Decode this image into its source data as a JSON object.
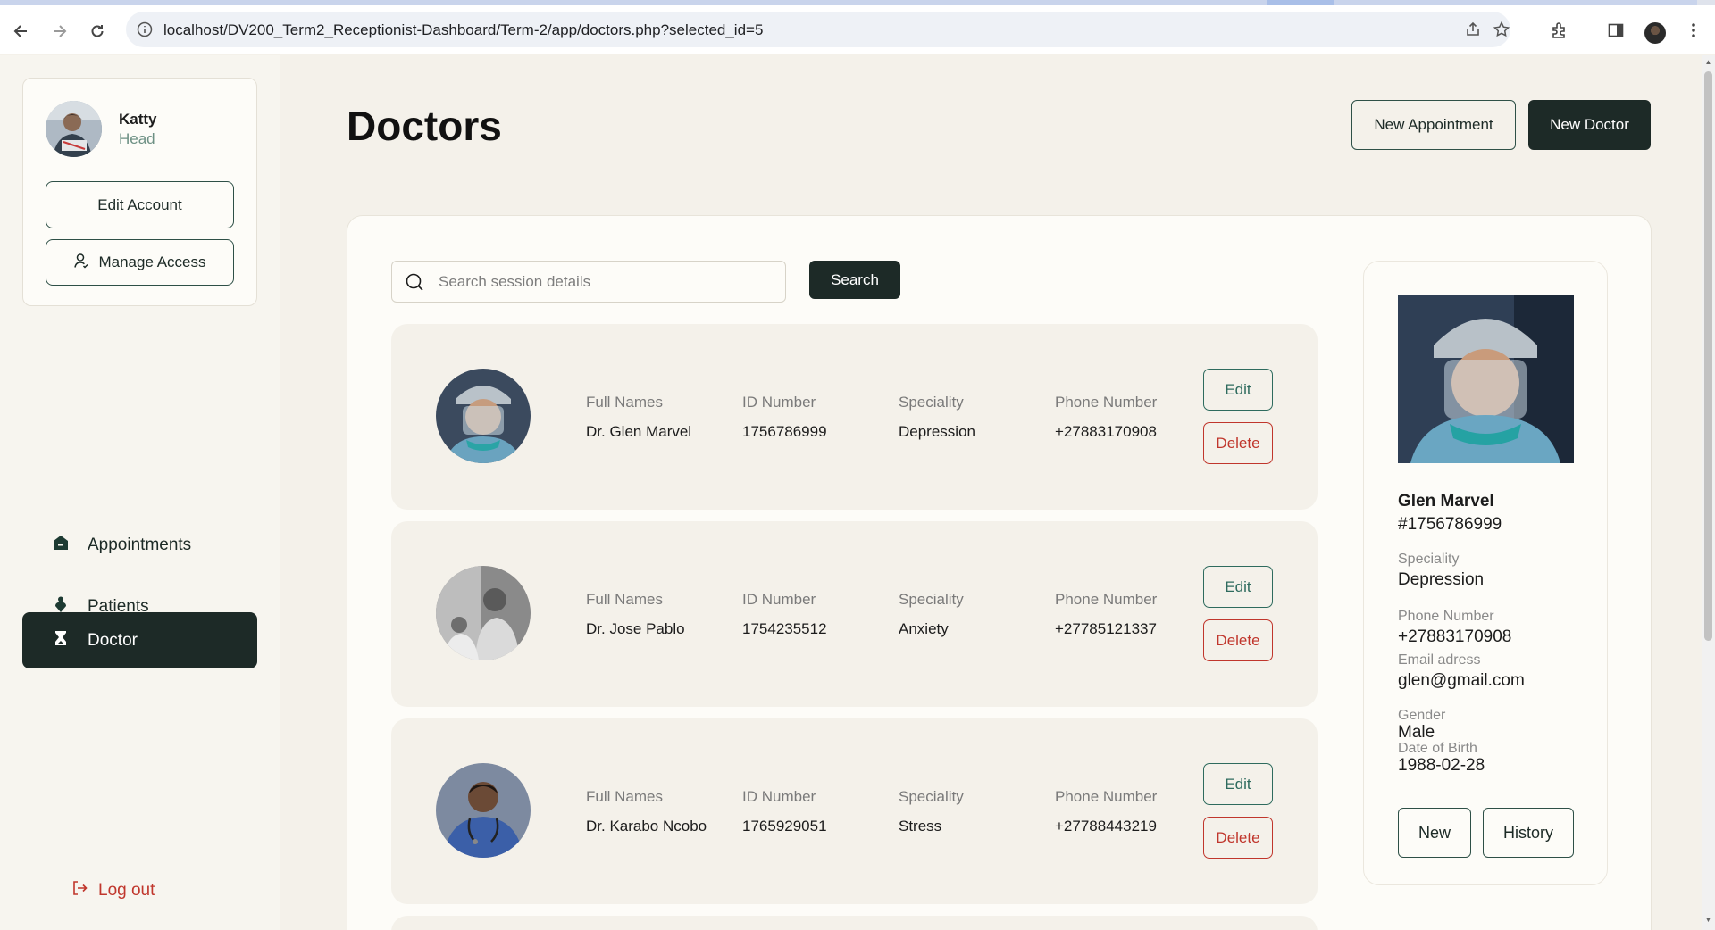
{
  "browser": {
    "url": "localhost/DV200_Term2_Receptionist-Dashboard/Term-2/app/doctors.php?selected_id=5"
  },
  "sidebar": {
    "user": {
      "name": "Katty",
      "role": "Head"
    },
    "edit_account_label": "Edit Account",
    "manage_access_label": "Manage Access",
    "nav": [
      {
        "label": "Appointments",
        "icon": "home-icon",
        "active": false
      },
      {
        "label": "Patients",
        "icon": "person-pin-icon",
        "active": false
      },
      {
        "label": "Doctor",
        "icon": "hourglass-icon",
        "active": true
      }
    ],
    "logout_label": "Log out"
  },
  "header": {
    "title": "Doctors",
    "new_appointment_label": "New Appointment",
    "new_doctor_label": "New Doctor"
  },
  "search": {
    "placeholder": "Search session details",
    "button_label": "Search"
  },
  "table": {
    "labels": {
      "full_names": "Full Names",
      "id_number": "ID Number",
      "speciality": "Speciality",
      "phone_number": "Phone Number"
    },
    "edit_label": "Edit",
    "delete_label": "Delete",
    "rows": [
      {
        "full_name": "Dr. Glen Marvel",
        "id_number": "1756786999",
        "speciality": "Depression",
        "phone": "+27883170908"
      },
      {
        "full_name": "Dr. Jose Pablo",
        "id_number": "1754235512",
        "speciality": "Anxiety",
        "phone": "+27785121337"
      },
      {
        "full_name": "Dr. Karabo Ncobo",
        "id_number": "1765929051",
        "speciality": "Stress",
        "phone": "+27788443219"
      }
    ]
  },
  "details": {
    "name": "Glen Marvel",
    "id": "#1756786999",
    "speciality_label": "Speciality",
    "speciality": "Depression",
    "phone_label": "Phone Number",
    "phone": "+27883170908",
    "email_label": "Email adress",
    "email": "glen@gmail.com",
    "gender_label": "Gender",
    "gender": "Male",
    "dob_label": "Date of Birth",
    "dob": "1988-02-28",
    "new_label": "New",
    "history_label": "History"
  },
  "colors": {
    "accent_dark": "#1d2a27",
    "accent_green": "#2e6b5e",
    "danger": "#c0362c",
    "page_bg": "#f4f1ea"
  }
}
